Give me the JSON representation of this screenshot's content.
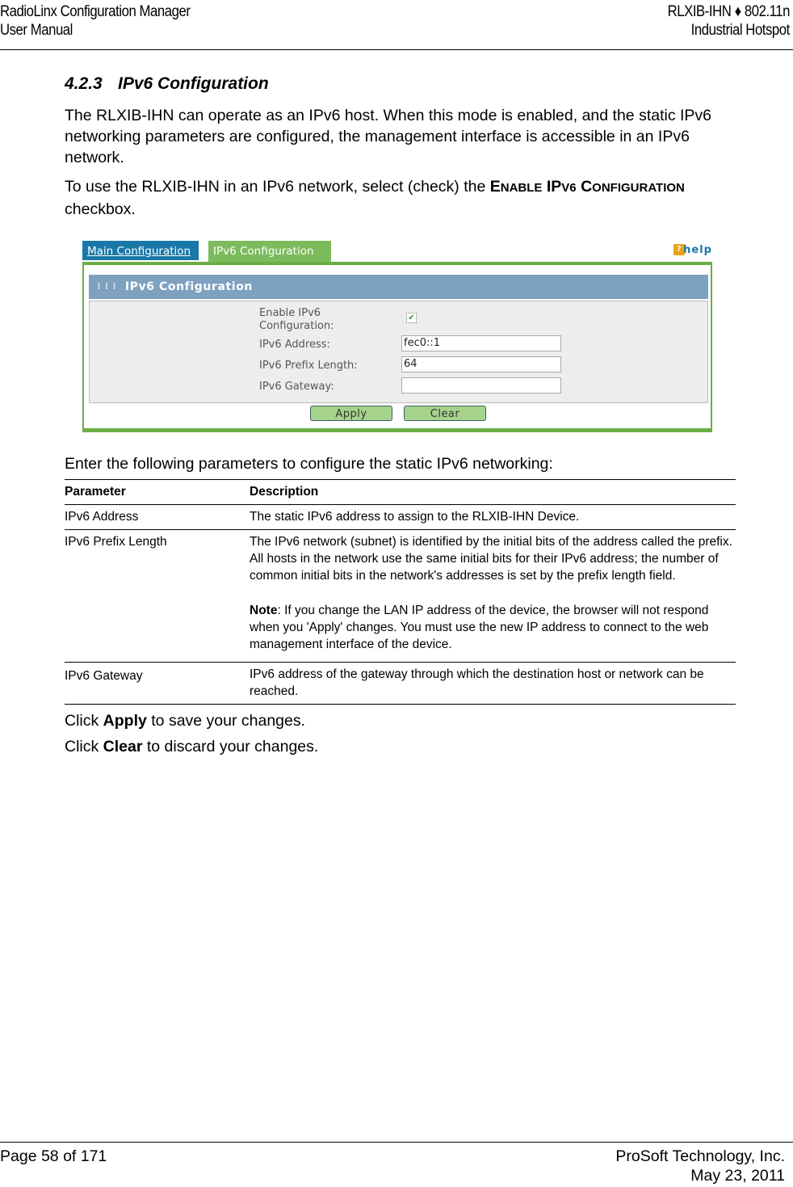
{
  "header": {
    "left_line1": "RadioLinx Configuration Manager",
    "left_line2": "User Manual",
    "right_line1": "RLXIB-IHN ♦ 802.11n",
    "right_line2": "Industrial Hotspot"
  },
  "section": {
    "number": "4.2.3",
    "title": "IPv6 Configuration",
    "intro_paragraph": "The RLXIB-IHN can operate as an IPv6 host. When this mode is enabled, and the static IPv6 networking parameters are configured, the management interface is accessible in an IPv6 network.",
    "instruction_prefix": "To use the RLXIB-IHN in an IPv6 network, select (check) the ",
    "instruction_term_1": "E",
    "instruction_term_1_sc": "NABLE",
    "instruction_term_2": "IP",
    "instruction_term_2_sc": "V6",
    "instruction_term_3": "C",
    "instruction_term_3_sc": "ONFIGURATION",
    "instruction_suffix": " checkbox."
  },
  "screenshot": {
    "tabs": [
      {
        "label": "Main Configuration",
        "active": false
      },
      {
        "label": "IPv6 Configuration",
        "active": true
      }
    ],
    "help_label": "help",
    "panel_title": "IPv6 Configuration",
    "fields": {
      "enable_label_line1": "Enable IPv6",
      "enable_label_line2": "Configuration:",
      "enable_checked": true,
      "address_label": "IPv6 Address:",
      "address_value": "fec0::1",
      "prefix_label": "IPv6 Prefix Length:",
      "prefix_value": "64",
      "gateway_label": "IPv6 Gateway:",
      "gateway_value": ""
    },
    "buttons": {
      "apply": "Apply",
      "clear": "Clear"
    },
    "colors": {
      "tab_main": "#1a78a8",
      "tab_active": "#7cbb5c",
      "frame_border": "#6aae45",
      "panel_title_bg": "#7ea1bf",
      "panel_body_bg": "#ededed",
      "button_bg": "#a6d38b"
    }
  },
  "table_intro": "Enter the following parameters to configure the static IPv6 networking:",
  "table": {
    "headers": [
      "Parameter",
      "Description"
    ],
    "rows": [
      {
        "parameter": "IPv6 Address",
        "description": "The static IPv6 address to assign to the RLXIB-IHN Device."
      },
      {
        "parameter": "IPv6 Prefix Length",
        "description": "The IPv6 network (subnet) is identified by the initial bits of the address called the prefix. All hosts in the network use the same initial bits for their IPv6 address; the number of common initial bits in the network's addresses is set by the prefix length field.",
        "note_label": "Note",
        "note_text": ": If you change the LAN IP address of the device, the browser will not respond when you 'Apply' changes. You must use the new IP address to connect to the web management interface of the device."
      },
      {
        "parameter": "IPv6 Gateway",
        "description": "IPv6 address of the gateway through which the destination host or network can be reached."
      }
    ]
  },
  "closing": {
    "apply_prefix": "Click ",
    "apply_term": "Apply",
    "apply_suffix": " to save your changes.",
    "clear_prefix": "Click ",
    "clear_term": "Clear",
    "clear_suffix": " to discard your changes."
  },
  "footer": {
    "page": "Page 58 of 171",
    "company": "ProSoft Technology, Inc.",
    "date": "May 23, 2011"
  }
}
